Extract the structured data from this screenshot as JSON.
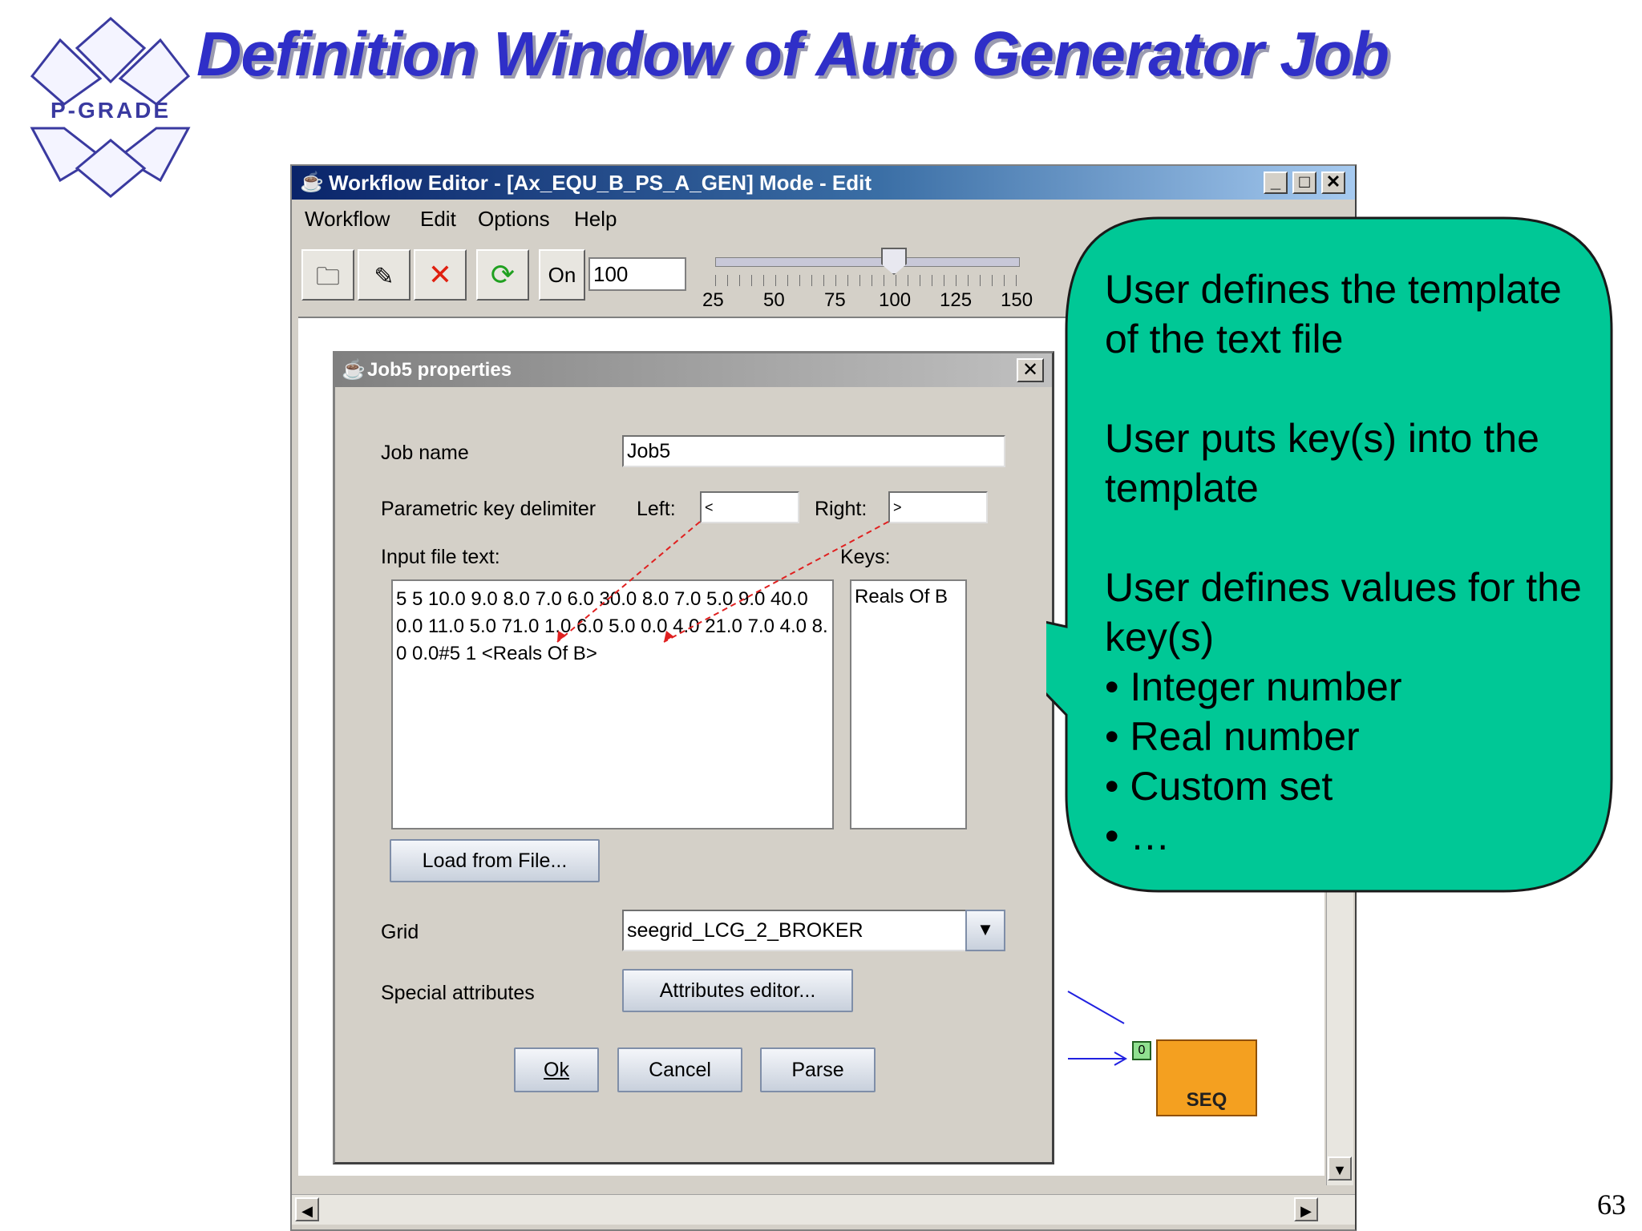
{
  "slide": {
    "title": "Definition Window of Auto Generator Job",
    "logo_text": "P-GRADE",
    "page_number": "63"
  },
  "window": {
    "title": "Workflow Editor - [Ax_EQU_B_PS_A_GEN]  Mode - Edit",
    "controls": [
      "_",
      "□",
      "✕"
    ],
    "menu": [
      "Workflow",
      "Edit",
      "Options",
      "Help"
    ],
    "toolbar": {
      "on_label": "On",
      "zoom_value": "100",
      "slider_value": 100,
      "slider_ticks": [
        "25",
        "50",
        "75",
        "100",
        "125",
        "150"
      ]
    },
    "seq_node_label": "SEQ",
    "port_label": "0"
  },
  "dialog": {
    "title": "Job5 properties",
    "close": "✕",
    "job_name_label": "Job name",
    "job_name_value": "Job5",
    "delimiter_label": "Parametric key delimiter",
    "left_label": "Left:",
    "left_value": "<",
    "right_label": "Right:",
    "right_value": ">",
    "input_text_label": "Input file text:",
    "keys_label": "Keys:",
    "input_text": "5 5 10.0 9.0 8.0 7.0 6.0 30.0 8.0 7.0 5.0 9.0 40.0 0.0 11.0 5.0 71.0 1.0 6.0 5.0 0.0 4.0 21.0 7.0 4.0 8.0 0.0#5 1 <Reals Of B>",
    "keys": [
      "Reals Of B"
    ],
    "load_button": "Load from File...",
    "grid_label": "Grid",
    "grid_value": "seegrid_LCG_2_BROKER",
    "special_label": "Special attributes",
    "attributes_button": "Attributes editor...",
    "ok_button": "Ok",
    "cancel_button": "Cancel",
    "parse_button": "Parse"
  },
  "callout": {
    "color": "#00c896",
    "paragraphs": [
      "User defines the template of the text file",
      "User puts key(s) into the template",
      "User defines values for the key(s)"
    ],
    "bullets": [
      "Integer number",
      "Real number",
      "Custom set",
      "…"
    ]
  }
}
